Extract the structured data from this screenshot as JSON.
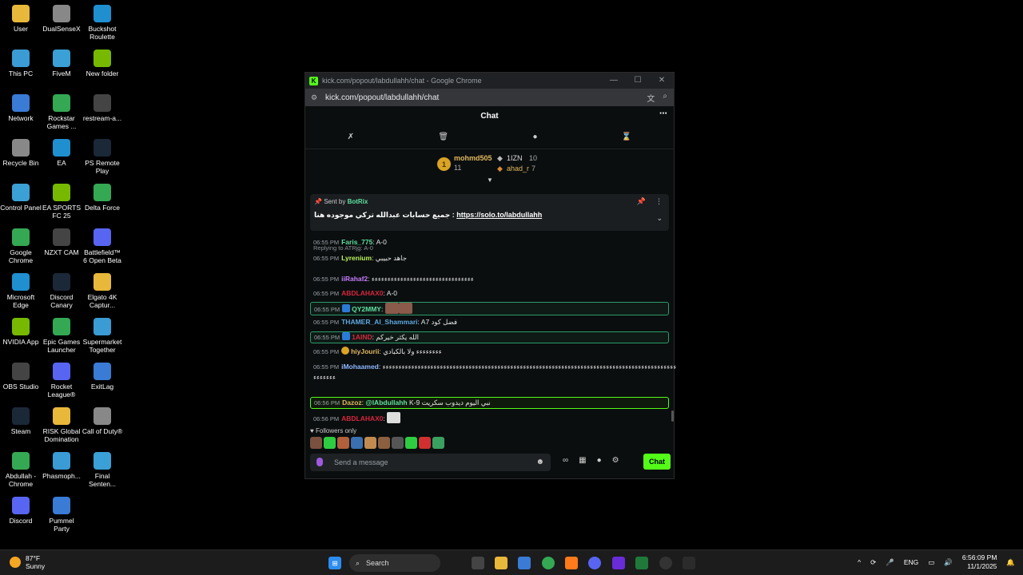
{
  "desktop": {
    "col1": [
      "User",
      "This PC",
      "Network",
      "Recycle Bin",
      "Control Panel",
      "Google Chrome",
      "Microsoft Edge",
      "NVIDIA App",
      "OBS Studio",
      "Steam",
      "Abdullah - Chrome",
      "Discord"
    ],
    "col2": [
      "DualSenseX",
      "FiveM",
      "Rockstar Games ...",
      "EA",
      "EA SPORTS FC 25",
      "NZXT CAM",
      "Discord Canary",
      "Epic Games Launcher",
      "Rocket League®",
      "RISK Global Domination",
      "Phasmoph...",
      "Pummel Party"
    ],
    "col3": [
      "Buckshot Roulette",
      "New folder",
      "restream-a...",
      "PS Remote Play",
      "Delta Force",
      "Battlefield™ 6 Open Beta",
      "Elgato 4K Captur...",
      "Supermarket Together",
      "ExitLag",
      "Call of Duty®",
      "Final Senten..."
    ]
  },
  "window": {
    "title": "kick.com/popout/labdullahh/chat - Google Chrome",
    "url": "kick.com/popout/labdullahh/chat",
    "chat_title": "Chat"
  },
  "leaderboard": {
    "first_rank": "1",
    "first_name": "mohmd505",
    "first_count": "11",
    "second_name": "1IZN",
    "second_count": "10",
    "third_name": "ahad_r",
    "third_count": "7"
  },
  "pinned": {
    "sent_by_label": "Sent by",
    "sent_by_user": "BotRix",
    "message": "جميع حسابات عبدالله تركي موجوده هنا :",
    "link": "https://solo.to/labdullahh"
  },
  "messages": [
    {
      "time": "06:55 PM",
      "user": "Faris_775",
      "text": "A-0",
      "color": "#5ee0a0"
    },
    {
      "time": "06:55 PM",
      "user": "Lyrenium",
      "text": "جاهد حبيبي",
      "color": "#b9f35a",
      "reply": "Replying to ATRjg: A-0"
    },
    {
      "time": "06:55 PM",
      "user": "iiRahaf2",
      "text": "ءءءءءءءءءءءءءءءءءءءءءءءءءءءءءءءء",
      "color": "#c77dff"
    },
    {
      "time": "06:55 PM",
      "user": "ABDLAHAX0",
      "text": "A-0",
      "color": "#d7263d"
    },
    {
      "time": "06:55 PM",
      "user": "QY2MMY",
      "text": "",
      "color": "#5ee0a0"
    },
    {
      "time": "06:55 PM",
      "user": "THAMER_Al_Shammari",
      "text": "A7 فضل كود",
      "color": "#5ea9e0"
    },
    {
      "time": "06:55 PM",
      "user": "1AIND",
      "text": "الله يكثر خيركم",
      "color": "#d7263d"
    },
    {
      "time": "06:55 PM",
      "user": "hiyJourii",
      "text": "ءءءءءءءء ولا بالكبادي",
      "color": "#e0b85e"
    },
    {
      "time": "06:55 PM",
      "user": "iMohaamed",
      "text": "ءءءءءءءءءءءءءءءءءءءءءءءءءءءءءءءءءءءءءءءءءءءءءءءءءءءءءءءءءءءءءءءءءءءءءءءءءءءءءءءءءءءءءءءءءءءء",
      "text2": "ءءءءءءء",
      "color": "#8fb7ff"
    },
    {
      "time": "06:56 PM",
      "user": "Dazoz",
      "mention": "@lAbdullahh",
      "text": "K-9 نبي اليوم ديدوب سكريت",
      "color": "#e0b85e"
    },
    {
      "time": "06:56 PM",
      "user": "ABDLAHAX0",
      "text": "",
      "color": "#d7263d"
    }
  ],
  "footer": {
    "followers_only": "Followers only",
    "placeholder": "Send a message",
    "chat_button": "Chat"
  },
  "taskbar": {
    "weather_temp": "87°F",
    "weather_cond": "Sunny",
    "search": "Search",
    "lang": "ENG",
    "time": "6:56:09 PM",
    "date": "11/1/2025"
  }
}
